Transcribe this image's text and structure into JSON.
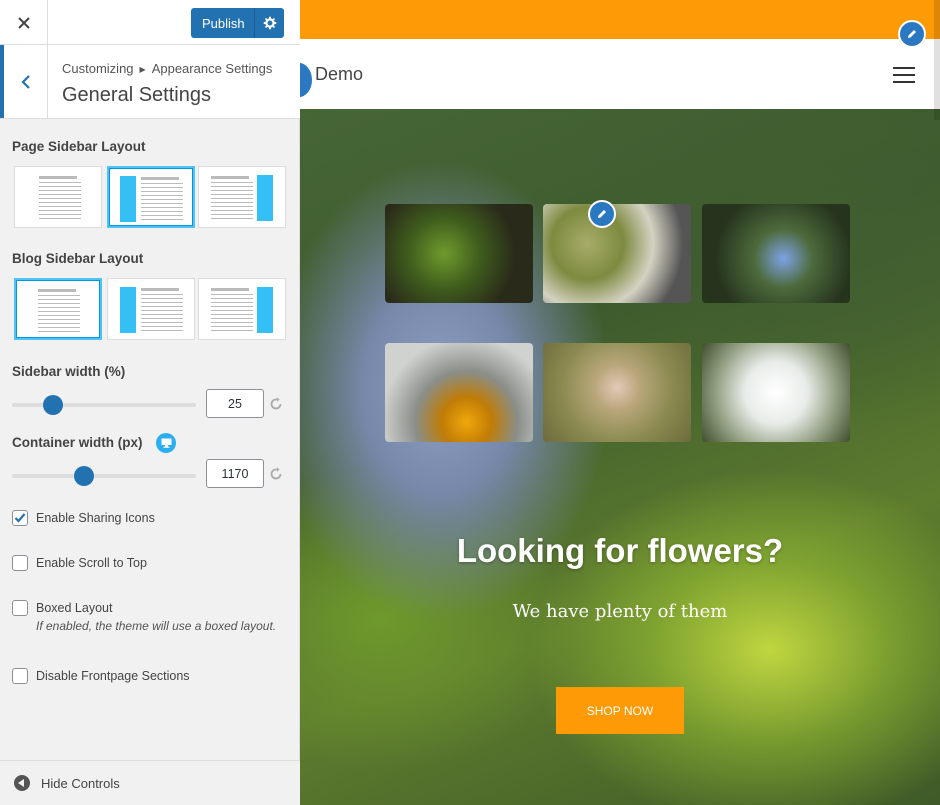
{
  "header": {
    "close_icon": "close-icon",
    "publish_label": "Publish",
    "settings_icon": "gear-icon"
  },
  "breadcrumb": {
    "parent": "Customizing",
    "section": "Appearance Settings",
    "title": "General Settings"
  },
  "page_sidebar_layout": {
    "label": "Page Sidebar Layout",
    "selected": "left-sidebar"
  },
  "blog_sidebar_layout": {
    "label": "Blog Sidebar Layout",
    "selected": "no-sidebar"
  },
  "sidebar_width": {
    "label": "Sidebar width (%)",
    "value": "25",
    "fraction": 0.19
  },
  "container_width": {
    "label": "Container width (px)",
    "value": "1170",
    "fraction": 0.38,
    "device_icon": "desktop-icon"
  },
  "checkboxes": {
    "sharing": {
      "label": "Enable Sharing Icons",
      "checked": true
    },
    "scroll_top": {
      "label": "Enable Scroll to Top",
      "checked": false
    },
    "boxed": {
      "label": "Boxed Layout",
      "checked": false,
      "description": "If enabled, the theme will use a boxed layout."
    },
    "frontpage": {
      "label": "Disable Frontpage Sections",
      "checked": false
    }
  },
  "footer": {
    "hide_label": "Hide Controls"
  },
  "preview": {
    "site_name": "Demo",
    "hero_title": "Looking for flowers?",
    "hero_subtitle": "We have plenty of them",
    "cta_label": "SHOP NOW",
    "colors": {
      "accent": "#fd9a06",
      "primary": "#2271b1",
      "selected": "#34c0f4"
    }
  }
}
